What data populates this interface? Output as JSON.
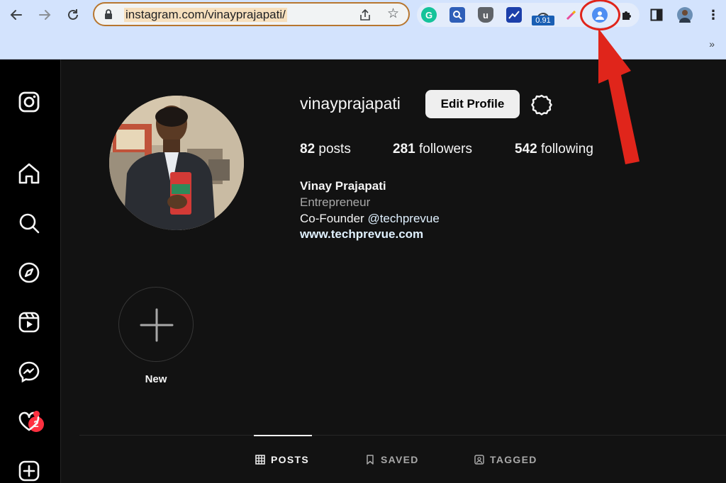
{
  "browser": {
    "url": "instagram.com/vinayprajapati/",
    "extension_badge": "0.91",
    "bookmarks_overflow": "»"
  },
  "profile": {
    "username": "vinayprajapati",
    "edit_button": "Edit Profile",
    "stats": {
      "posts_count": "82",
      "posts_label": "posts",
      "followers_count": "281",
      "followers_label": "followers",
      "following_count": "542",
      "following_label": "following"
    },
    "bio": {
      "full_name": "Vinay Prajapati",
      "category": "Entrepreneur",
      "line_prefix": "Co-Founder ",
      "mention": "@techprevue",
      "website": "www.techprevue.com"
    },
    "highlight_new_label": "New"
  },
  "nav": {
    "messages_badge": "2"
  },
  "tabs": {
    "posts": "POSTS",
    "saved": "SAVED",
    "tagged": "TAGGED"
  },
  "colors": {
    "annotation_red": "#e0251b",
    "instagram_bg": "#121212",
    "notification_red": "#ff3040"
  }
}
